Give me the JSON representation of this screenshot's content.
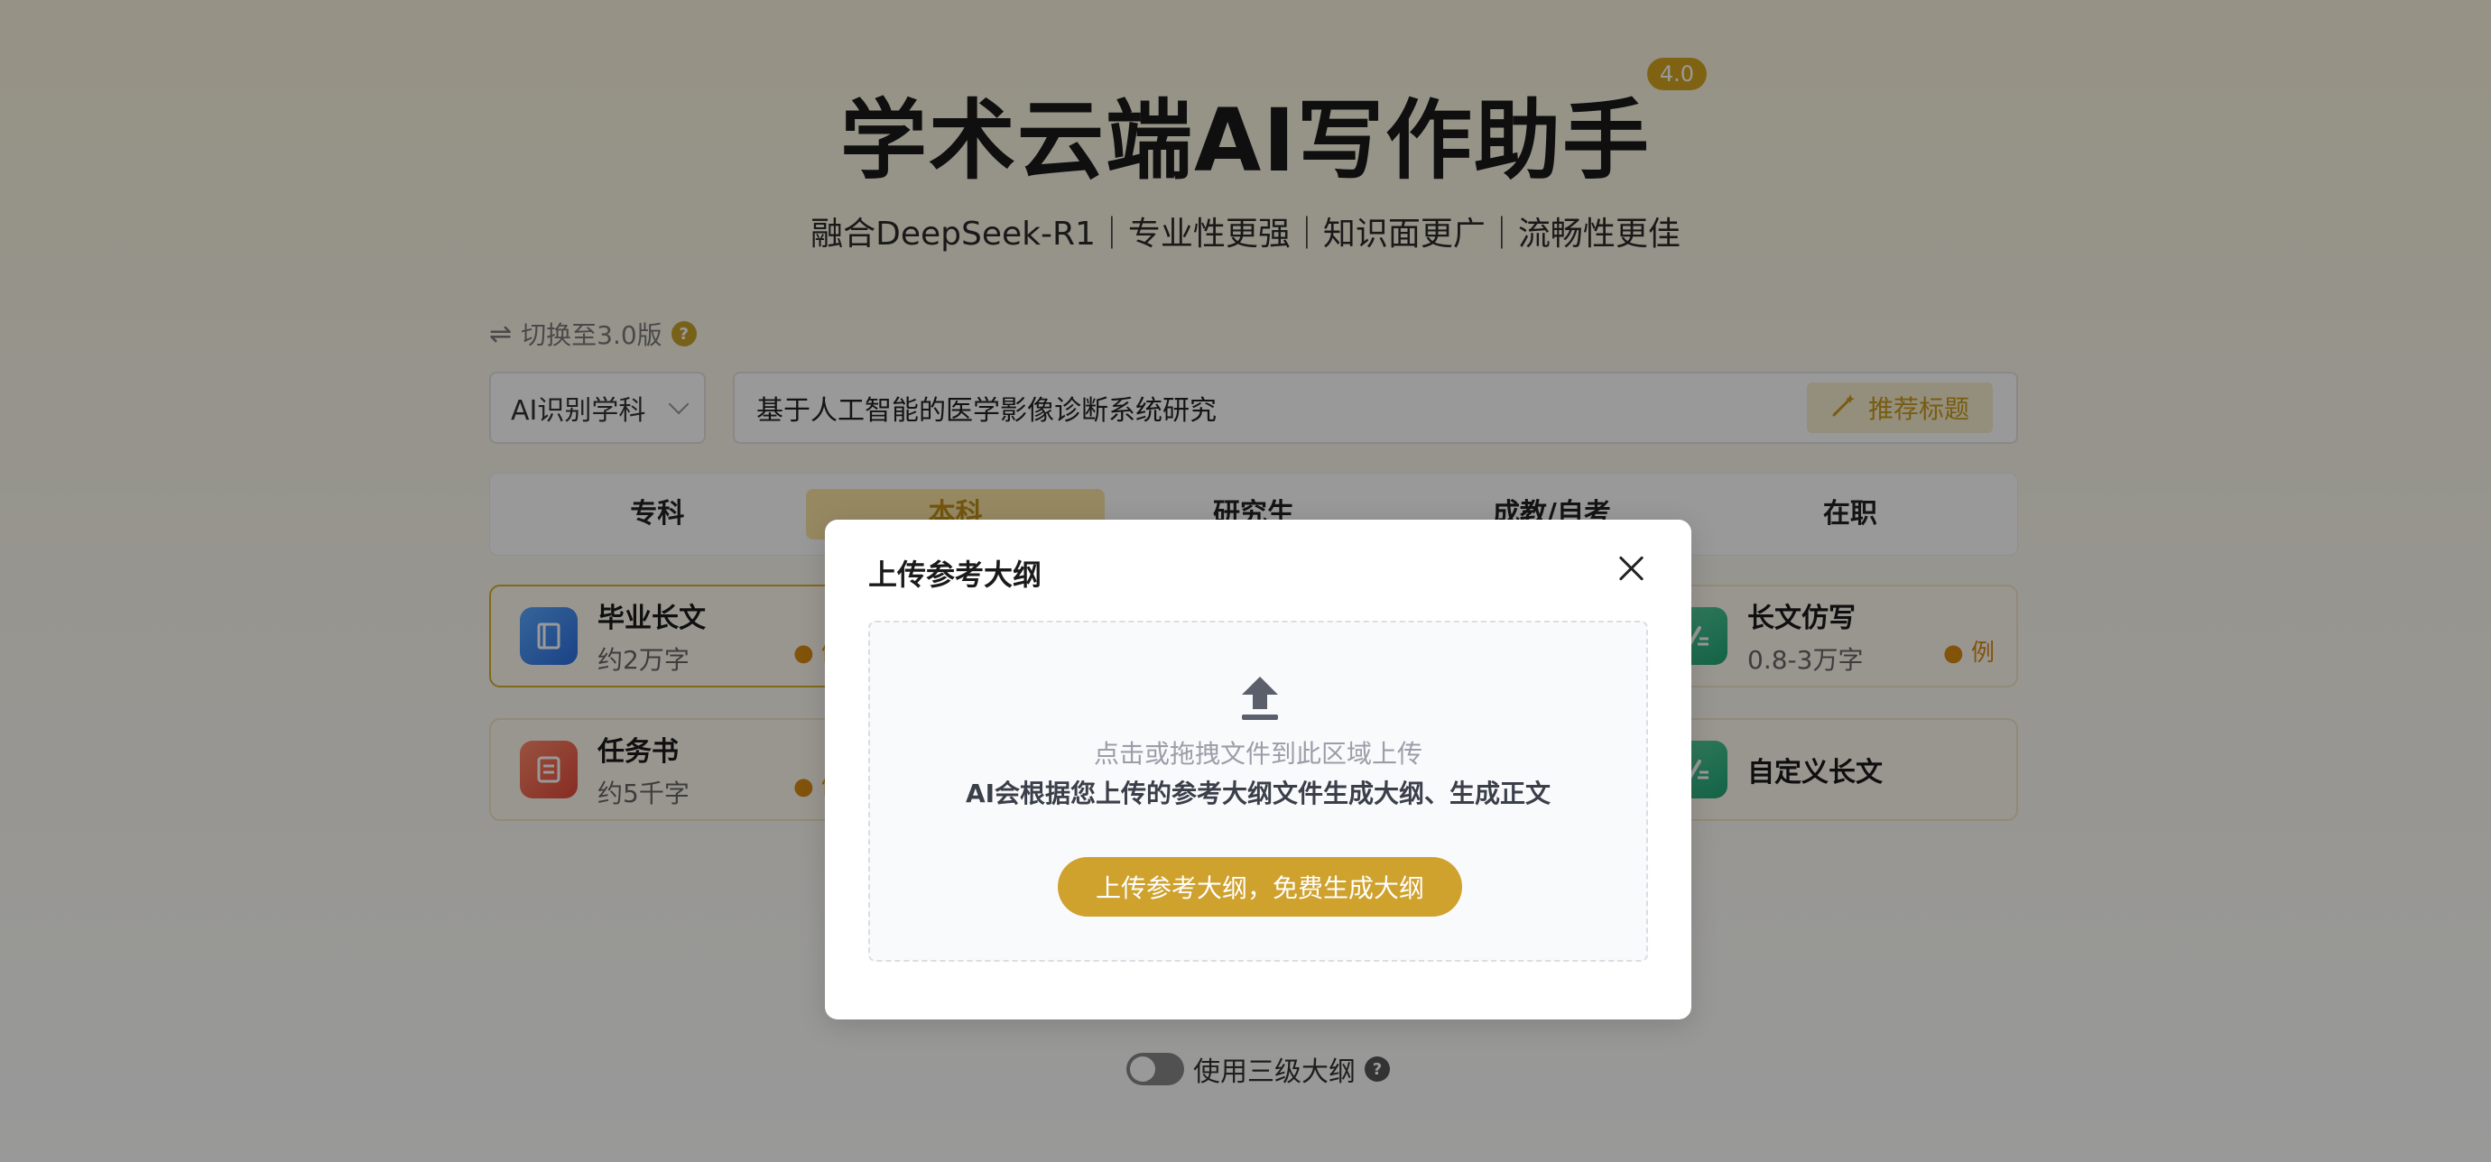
{
  "header": {
    "title": "学术云端AI写作助手",
    "version": "4.0",
    "subtitle": "融合DeepSeek-R1｜专业性更强｜知识面更广｜流畅性更佳"
  },
  "switch_version": {
    "label": "切换至3.0版",
    "help": "?"
  },
  "form": {
    "subject_select": "AI识别学科",
    "title_value": "基于人工智能的医学影像诊断系统研究",
    "recommend_label": "推荐标题"
  },
  "levels": {
    "active_index": 1,
    "items": [
      "专科",
      "本科",
      "研究生",
      "成教/自考",
      "在职"
    ]
  },
  "cards": [
    {
      "title": "毕业长文",
      "subtitle": "约2万字",
      "example": "例"
    },
    {
      "title": "任务书",
      "subtitle": "约5千字",
      "example": "例"
    },
    {
      "title": "长文仿写",
      "subtitle": "0.8-3万字",
      "example": "例"
    },
    {
      "title": "自定义长文",
      "subtitle": ""
    }
  ],
  "options": {
    "three_level_outline": "使用三级大纲",
    "help": "?",
    "three_level_outline_enabled": false
  },
  "modal": {
    "title": "上传参考大纲",
    "hint": "点击或拖拽文件到此区域上传",
    "description": "AI会根据您上传的参考大纲文件生成大纲、生成正文",
    "button": "上传参考大纲，免费生成大纲"
  },
  "colors": {
    "accent": "#cfa12d",
    "badge": "#d4a520",
    "active_tab_bg": "#fbe4a3"
  }
}
